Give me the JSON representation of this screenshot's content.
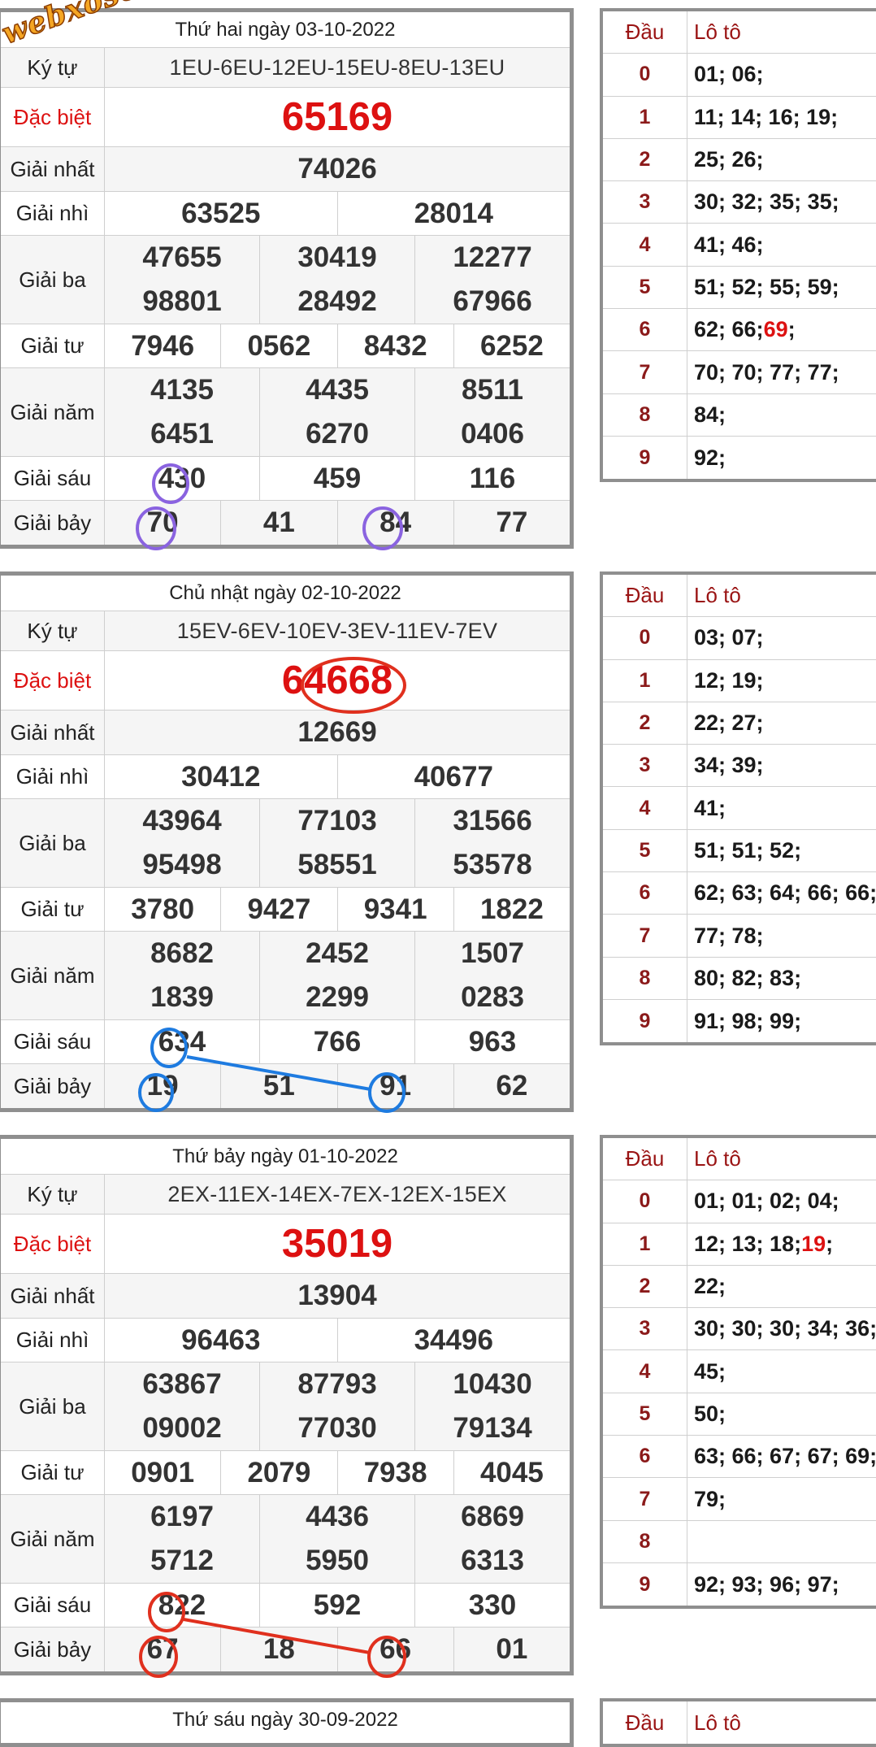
{
  "watermark": "webxoso.net",
  "labels": {
    "code": "Ký tự",
    "special": "Đặc biệt",
    "first": "Giải nhất",
    "second": "Giải nhì",
    "third": "Giải ba",
    "fourth": "Giải tư",
    "fifth": "Giải năm",
    "sixth": "Giải sáu",
    "seventh": "Giải bảy",
    "dau": "Đầu",
    "loto": "Lô tô"
  },
  "draws": [
    {
      "date": "Thứ hai ngày 03-10-2022",
      "code": "1EU-6EU-12EU-15EU-8EU-13EU",
      "special": "65169",
      "first": "74026",
      "second": [
        "63525",
        "28014"
      ],
      "third": [
        "47655",
        "30419",
        "12277",
        "98801",
        "28492",
        "67966"
      ],
      "fourth": [
        "7946",
        "0562",
        "8432",
        "6252"
      ],
      "fifth": [
        "4135",
        "4435",
        "8511",
        "6451",
        "6270",
        "0406"
      ],
      "sixth": [
        "430",
        "459",
        "116"
      ],
      "seventh": [
        "70",
        "41",
        "84",
        "77"
      ],
      "loto": [
        "01; 06;",
        "11; 14; 16; 19;",
        "25; 26;",
        "30; 32; 35; 35;",
        "41; 46;",
        "51; 52; 55; 59;",
        "62; 66; ",
        "70; 70; 77; 77;",
        "84;",
        "92;"
      ],
      "loto_hot": {
        "6": "69"
      }
    },
    {
      "date": "Chủ nhật ngày 02-10-2022",
      "code": "15EV-6EV-10EV-3EV-11EV-7EV",
      "special": "64668",
      "first": "12669",
      "second": [
        "30412",
        "40677"
      ],
      "third": [
        "43964",
        "77103",
        "31566",
        "95498",
        "58551",
        "53578"
      ],
      "fourth": [
        "3780",
        "9427",
        "9341",
        "1822"
      ],
      "fifth": [
        "8682",
        "2452",
        "1507",
        "1839",
        "2299",
        "0283"
      ],
      "sixth": [
        "634",
        "766",
        "963"
      ],
      "seventh": [
        "19",
        "51",
        "91",
        "62"
      ],
      "loto": [
        "03; 07;",
        "12; 19;",
        "22; 27;",
        "34; 39;",
        "41;",
        "51; 51; 52;",
        "62; 63; 64; 66; 66;",
        "77; 78;",
        "80; 82; 83;",
        "91; 98; 99;"
      ],
      "loto_hot": {}
    },
    {
      "date": "Thứ bảy ngày 01-10-2022",
      "code": "2EX-11EX-14EX-7EX-12EX-15EX",
      "special": "35019",
      "first": "13904",
      "second": [
        "96463",
        "34496"
      ],
      "third": [
        "63867",
        "87793",
        "10430",
        "09002",
        "77030",
        "79134"
      ],
      "fourth": [
        "0901",
        "2079",
        "7938",
        "4045"
      ],
      "fifth": [
        "6197",
        "4436",
        "6869",
        "5712",
        "5950",
        "6313"
      ],
      "sixth": [
        "822",
        "592",
        "330"
      ],
      "seventh": [
        "67",
        "18",
        "66",
        "01"
      ],
      "loto": [
        "01; 01; 02; 04;",
        "12; 13; 18; ",
        "22;",
        "30; 30; 30; 34; 36;",
        "45;",
        "50;",
        "63; 66; 67; 67; 69;",
        "79;",
        "",
        "92; 93; 96; 97;"
      ],
      "loto_hot": {
        "1": "19"
      }
    }
  ],
  "partial": {
    "date": "Thứ sáu ngày 30-09-2022"
  },
  "colors": {
    "special": "#dd1111",
    "border": "#8f8f8f",
    "dau_text": "#8b1a1a",
    "circle_purple": "#8a63e0",
    "circle_blue": "#1e7be0",
    "circle_red": "#e0301e"
  }
}
